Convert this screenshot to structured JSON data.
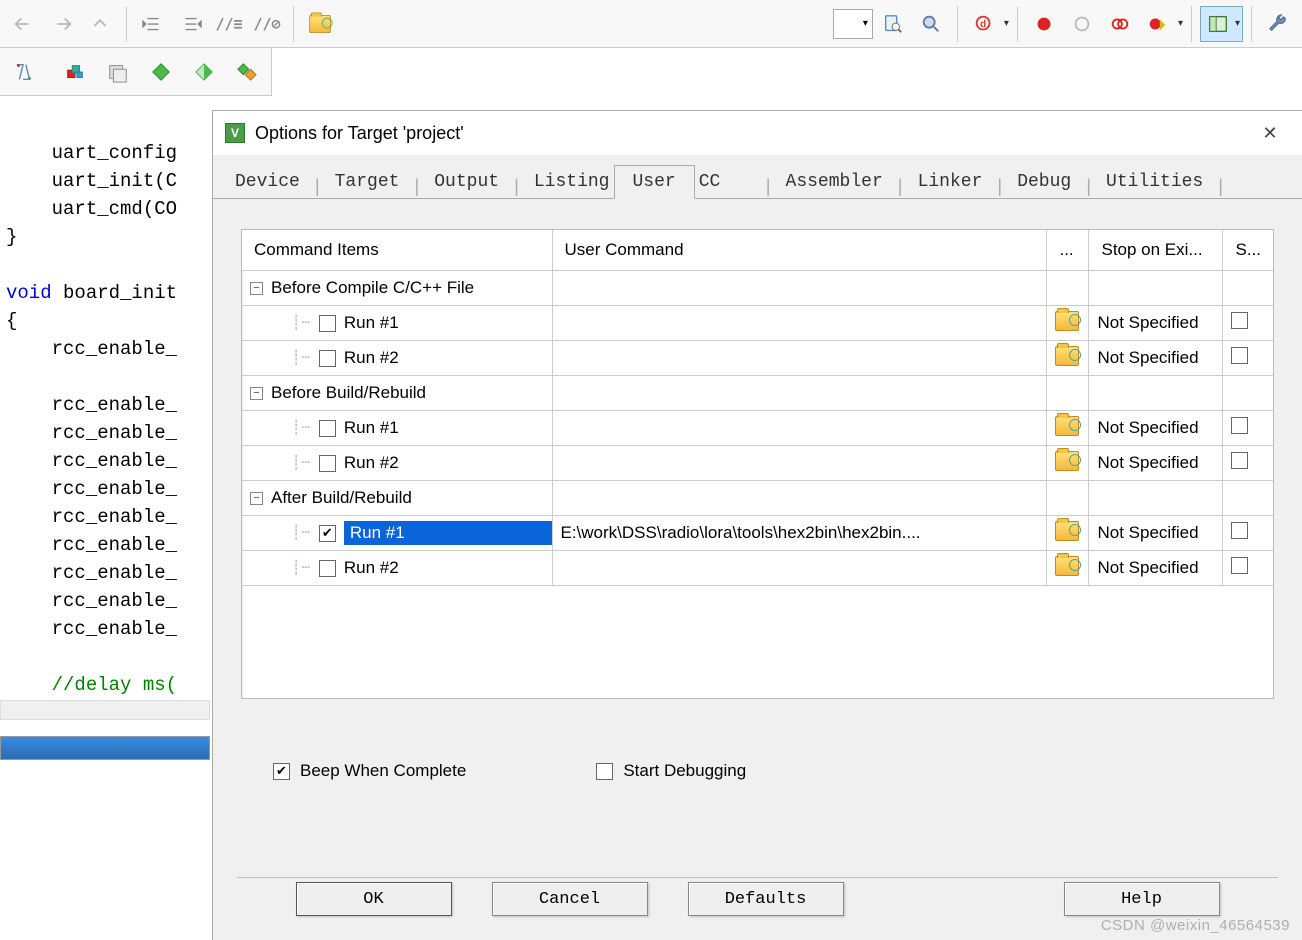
{
  "dialog": {
    "title": "Options for Target 'project'",
    "tabs": [
      "Device",
      "Target",
      "Output",
      "Listing",
      "User",
      "CC",
      "Assembler",
      "Linker",
      "Debug",
      "Utilities"
    ],
    "active_tab": "User"
  },
  "grid": {
    "headers": {
      "cmd_items": "Command Items",
      "user_cmd": "User Command",
      "btn": "...",
      "stop": "Stop on Exi...",
      "s": "S..."
    },
    "groups": [
      {
        "label": "Before Compile C/C++ File",
        "rows": [
          {
            "label": "Run #1",
            "checked": false,
            "cmd": "",
            "stop": "Not Specified",
            "s": false
          },
          {
            "label": "Run #2",
            "checked": false,
            "cmd": "",
            "stop": "Not Specified",
            "s": false
          }
        ]
      },
      {
        "label": "Before Build/Rebuild",
        "rows": [
          {
            "label": "Run #1",
            "checked": false,
            "cmd": "",
            "stop": "Not Specified",
            "s": false
          },
          {
            "label": "Run #2",
            "checked": false,
            "cmd": "",
            "stop": "Not Specified",
            "s": false
          }
        ]
      },
      {
        "label": "After Build/Rebuild",
        "rows": [
          {
            "label": "Run #1",
            "checked": true,
            "selected": true,
            "cmd": "E:\\work\\DSS\\radio\\lora\\tools\\hex2bin\\hex2bin....",
            "stop": "Not Specified",
            "s": false
          },
          {
            "label": "Run #2",
            "checked": false,
            "cmd": "",
            "stop": "Not Specified",
            "s": false
          }
        ]
      }
    ]
  },
  "checks": {
    "beep": "Beep When Complete",
    "beep_checked": true,
    "startdbg": "Start Debugging",
    "startdbg_checked": false
  },
  "buttons": {
    "ok": "OK",
    "cancel": "Cancel",
    "defaults": "Defaults",
    "help": "Help"
  },
  "code": {
    "l1": "    uart_config",
    "l2": "    uart_init(C",
    "l3": "    uart_cmd(CO",
    "l4": "}",
    "l5": "",
    "l6": "void",
    "l6b": " board_init",
    "l7": "{",
    "l8": "    rcc_enable_",
    "l9": "",
    "l10": "    rcc_enable_",
    "l11": "    rcc_enable_",
    "l12": "    rcc_enable_",
    "l13": "    rcc_enable_",
    "l14": "    rcc_enable_",
    "l15": "    rcc_enable_",
    "l16": "    rcc_enable_",
    "l17": "    rcc_enable_",
    "l18": "    rcc_enable_",
    "l19": "",
    "l20": "    //delay ms("
  },
  "watermark": "CSDN @weixin_46564539"
}
